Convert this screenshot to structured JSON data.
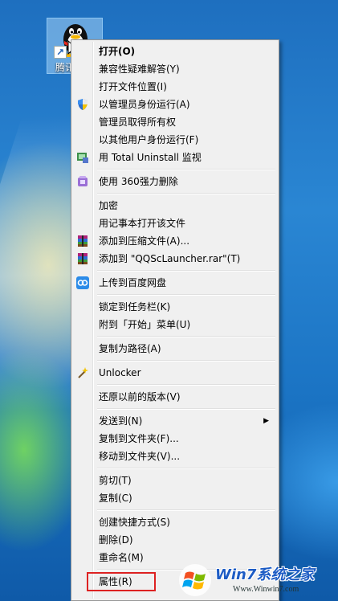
{
  "desktop_icon": {
    "label": "腾讯",
    "icon": "qq-penguin-icon",
    "overlay_icon": "shortcut-arrow-icon"
  },
  "menu": {
    "items": [
      {
        "type": "item",
        "label": "打开(O)",
        "bold": true
      },
      {
        "type": "item",
        "label": "兼容性疑难解答(Y)"
      },
      {
        "type": "item",
        "label": "打开文件位置(I)"
      },
      {
        "type": "item",
        "label": "以管理员身份运行(A)",
        "icon": "uac-shield-icon"
      },
      {
        "type": "item",
        "label": "管理员取得所有权"
      },
      {
        "type": "item",
        "label": "以其他用户身份运行(F)"
      },
      {
        "type": "item",
        "label": "用 Total Uninstall 监视",
        "icon": "total-uninstall-icon"
      },
      {
        "type": "sep"
      },
      {
        "type": "item",
        "label": "使用 360强力删除",
        "icon": "360-delete-icon"
      },
      {
        "type": "sep"
      },
      {
        "type": "item",
        "label": "加密"
      },
      {
        "type": "item",
        "label": "用记事本打开该文件"
      },
      {
        "type": "item",
        "label": "添加到压缩文件(A)...",
        "icon": "winrar-icon"
      },
      {
        "type": "item",
        "label": "添加到 \"QQScLauncher.rar\"(T)",
        "icon": "winrar-icon"
      },
      {
        "type": "sep"
      },
      {
        "type": "item",
        "label": "上传到百度网盘",
        "icon": "baidu-netdisk-icon"
      },
      {
        "type": "sep"
      },
      {
        "type": "item",
        "label": "锁定到任务栏(K)"
      },
      {
        "type": "item",
        "label": "附到「开始」菜单(U)"
      },
      {
        "type": "sep"
      },
      {
        "type": "item",
        "label": "复制为路径(A)"
      },
      {
        "type": "sep"
      },
      {
        "type": "item",
        "label": "Unlocker",
        "icon": "unlocker-wand-icon"
      },
      {
        "type": "sep"
      },
      {
        "type": "item",
        "label": "还原以前的版本(V)"
      },
      {
        "type": "sep"
      },
      {
        "type": "item",
        "label": "发送到(N)",
        "submenu": true
      },
      {
        "type": "item",
        "label": "复制到文件夹(F)..."
      },
      {
        "type": "item",
        "label": "移动到文件夹(V)..."
      },
      {
        "type": "sep"
      },
      {
        "type": "item",
        "label": "剪切(T)"
      },
      {
        "type": "item",
        "label": "复制(C)"
      },
      {
        "type": "sep"
      },
      {
        "type": "item",
        "label": "创建快捷方式(S)"
      },
      {
        "type": "item",
        "label": "删除(D)"
      },
      {
        "type": "item",
        "label": "重命名(M)"
      },
      {
        "type": "sep"
      },
      {
        "type": "item",
        "label": "属性(R)",
        "highlighted": true
      }
    ]
  },
  "watermark": {
    "title": "Win7系统之家",
    "url": "Www.Winwin7.com"
  },
  "colors": {
    "highlight_box": "#dd2222",
    "menu_bg": "#f0f0f0",
    "desktop_blue": "#1e6fbf"
  }
}
